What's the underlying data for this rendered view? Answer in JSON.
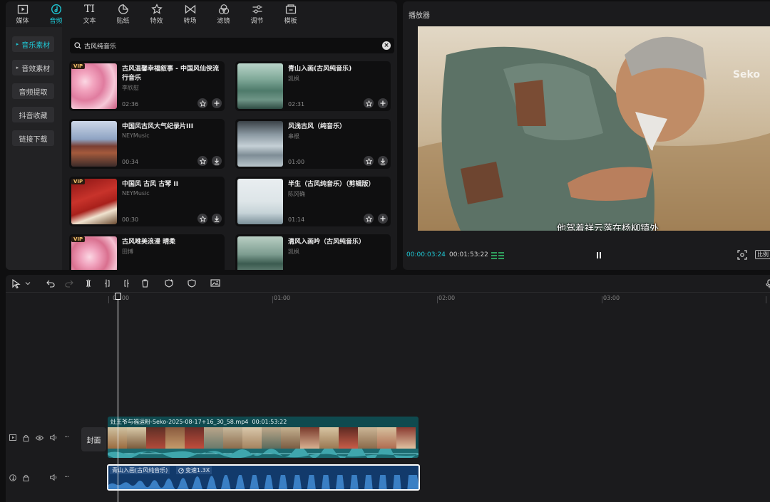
{
  "top_tabs": [
    {
      "label": "媒体",
      "icon": "media-icon"
    },
    {
      "label": "音频",
      "icon": "audio-icon",
      "active": true
    },
    {
      "label": "文本",
      "icon": "text-icon"
    },
    {
      "label": "贴纸",
      "icon": "sticker-icon"
    },
    {
      "label": "特效",
      "icon": "effects-icon"
    },
    {
      "label": "转场",
      "icon": "transition-icon"
    },
    {
      "label": "滤镜",
      "icon": "filter-icon"
    },
    {
      "label": "调节",
      "icon": "adjust-icon"
    },
    {
      "label": "模板",
      "icon": "template-icon"
    }
  ],
  "side_nav": [
    {
      "label": "音乐素材",
      "active": true,
      "expandable": true
    },
    {
      "label": "音效素材",
      "expandable": true
    },
    {
      "label": "音频提取"
    },
    {
      "label": "抖音收藏"
    },
    {
      "label": "链接下载"
    }
  ],
  "search": {
    "value": "古风纯音乐"
  },
  "cards": [
    {
      "title": "古风温馨幸福叙事 - 中国风仙侠流行音乐",
      "artist": "李欣慰",
      "duration": "02:36",
      "vip": "VIP",
      "action": "add"
    },
    {
      "title": "青山入画(古风纯音乐)",
      "artist": "凯枫",
      "duration": "02:31",
      "action": "add"
    },
    {
      "title": "中国风古风大气纪录片III",
      "artist": "NEYMusic",
      "duration": "00:34",
      "action": "download"
    },
    {
      "title": "风浅古风（纯音乐）",
      "artist": "串根",
      "duration": "01:00",
      "action": "download"
    },
    {
      "title": "中国风 古风 古琴 II",
      "artist": "NEYMusic",
      "duration": "00:30",
      "vip": "VIP",
      "action": "download"
    },
    {
      "title": "半生（古风纯音乐）（剪辑版）",
      "artist": "陈冈确",
      "duration": "01:14",
      "action": "add"
    },
    {
      "title": "古风唯美浪漫 晴柔",
      "artist": "田博",
      "duration": "",
      "vip": "VIP",
      "action": "add"
    },
    {
      "title": "清风入画吟（古风纯音乐）",
      "artist": "凯枫",
      "duration": "",
      "action": "add"
    }
  ],
  "player": {
    "title": "播放器",
    "subtitle": "他驾着祥云落在杨柳镇外",
    "logo": "Seko",
    "current_time": "00:00:03:24",
    "total_time": "00:01:53:22",
    "ratio_label": "比例"
  },
  "timeline": {
    "ruler": [
      "00:00",
      "01:00",
      "02:00",
      "03:00"
    ],
    "cover_label": "封面",
    "video_clip": {
      "name": "灶王爷与福运粉-Seko-2025-08-17+16_30_58.mp4",
      "duration": "00:01:53:22"
    },
    "audio_clip": {
      "name": "青山入画(古风纯音乐)",
      "speed": "变速1.3X"
    }
  },
  "colors": {
    "accent": "#1fc7d4",
    "panel": "#1b1b1d",
    "audio_clip": "#123a6b",
    "video_clip": "#0f4a4f"
  }
}
